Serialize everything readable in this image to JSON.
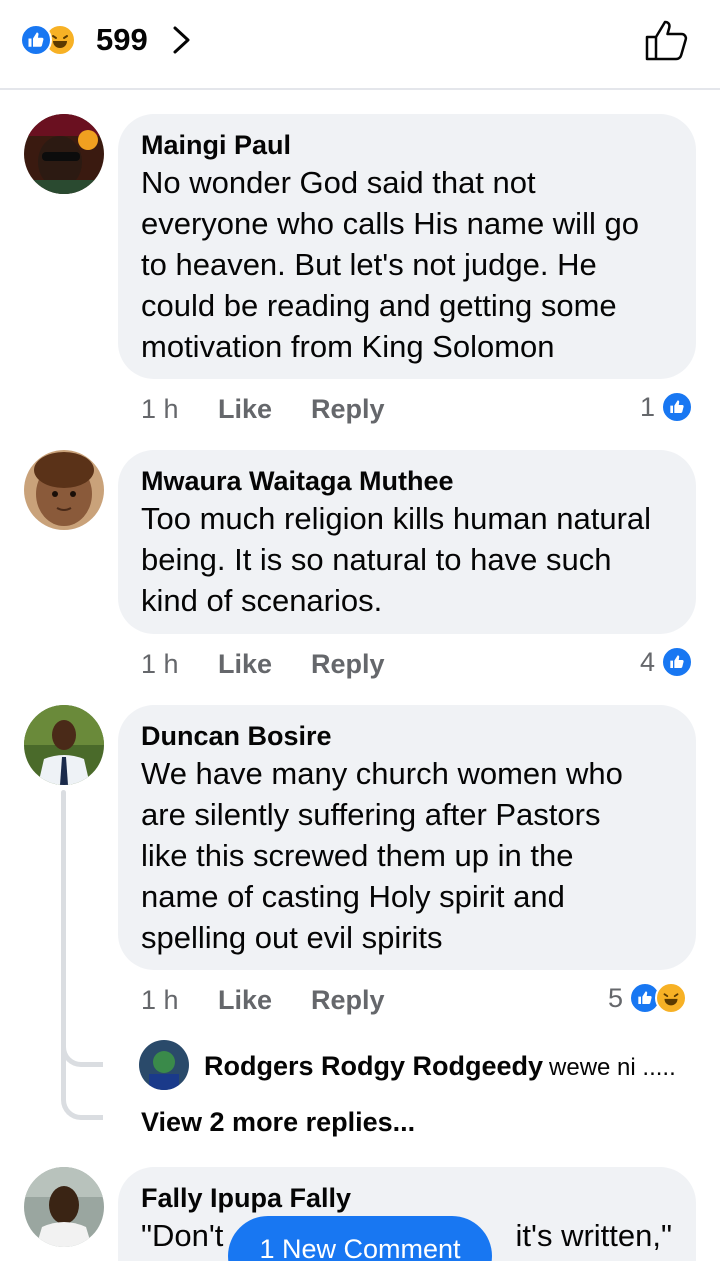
{
  "header": {
    "reaction_count": "599",
    "reaction_types": [
      "like-icon",
      "haha-icon"
    ]
  },
  "colors": {
    "accent": "#1877f2",
    "bubble": "#f0f2f5",
    "meta_text": "#65676b",
    "haha": "#f7b125"
  },
  "comments": [
    {
      "author": "Maingi Paul",
      "lines": [
        "No wonder God said that not",
        "everyone who calls His name will go",
        "to heaven. But let's not judge. He",
        "could be reading and getting some",
        "motivation from King Solomon"
      ],
      "time": "1 h",
      "like_label": "Like",
      "reply_label": "Reply",
      "reaction_count": "1"
    },
    {
      "author": "Mwaura Waitaga Muthee",
      "lines": [
        "Too much religion kills human natural",
        "being.  It is so natural to have such",
        "kind of scenarios."
      ],
      "time": "1 h",
      "like_label": "Like",
      "reply_label": "Reply",
      "reaction_count": "4"
    },
    {
      "author": "Duncan Bosire",
      "lines": [
        "We have many church women who",
        "are silently suffering after Pastors",
        "like this screwed them up in the",
        "name of casting Holy spirit and",
        "spelling out evil spirits"
      ],
      "time": "1 h",
      "like_label": "Like",
      "reply_label": "Reply",
      "reaction_count": "5",
      "reply_preview": {
        "author": "Rodgers Rodgy Rodgeedy",
        "text": "wewe ni ....."
      },
      "view_more": "View 2 more replies..."
    },
    {
      "author": "Fally Ipupa Fally",
      "line_start": "\"Don't",
      "line_end": "it's written,\""
    }
  ],
  "new_comment_button": "1 New Comment"
}
